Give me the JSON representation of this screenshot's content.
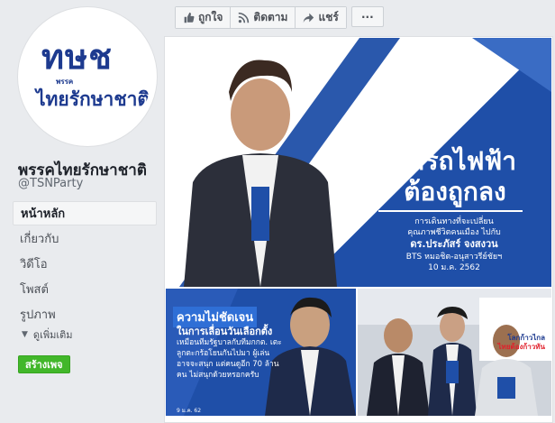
{
  "profile": {
    "logo_top": "ทษช",
    "logo_small": "พรรค",
    "logo_bottom": "ไทยรักษาชาติ",
    "name": "พรรคไทยรักษาชาติ",
    "handle": "@TSNParty"
  },
  "nav": {
    "items": [
      {
        "label": "หน้าหลัก",
        "active": true
      },
      {
        "label": "เกี่ยวกับ",
        "active": false
      },
      {
        "label": "วิดีโอ",
        "active": false
      },
      {
        "label": "โพสต์",
        "active": false
      },
      {
        "label": "รูปภาพ",
        "active": false
      }
    ],
    "more_label": "ดูเพิ่มเติม",
    "create_label": "สร้างเพจ"
  },
  "actions": {
    "like": "ถูกใจ",
    "follow": "ติดตาม",
    "share": "แชร์",
    "more": "···"
  },
  "post": {
    "headline_1": "ค่ารถไฟฟ้า",
    "headline_2": "ต้องถูกลง",
    "sub_1": "การเดินทางที่จะเปลี่ยน",
    "sub_2": "คุณภาพชีวิตคนเมือง ไปกับ",
    "sub_3": "ดร.ประภัสร์ จงสงวน",
    "sub_4": "BTS หมอชิต-อนุสาวรีย์ชัยฯ",
    "sub_5": "10 ม.ค. 2562",
    "quote_title": "ความไม่ชัดเจน",
    "quote_lead": "ในการเลื่อนวันเลือกตั้ง",
    "quote_body": "เหมือนทีมรัฐบาลกับทีมกกต. เตะลูกตะกร้อโยนกันไปมา ผู้เล่นอาจจะสนุก แต่คนดูอีก 70 ล้านคน ไม่สนุกด้วยหรอกครับ",
    "quote_date": "9 ม.ค. 62",
    "sign_1": "โลกก้าวไกล",
    "sign_2": "ไทยต้องก้าวทัน"
  },
  "colors": {
    "brand_blue": "#1d3a8f",
    "brand_red": "#e0202b",
    "poster_blue": "#1f4fa8",
    "create_green": "#42b72a"
  }
}
